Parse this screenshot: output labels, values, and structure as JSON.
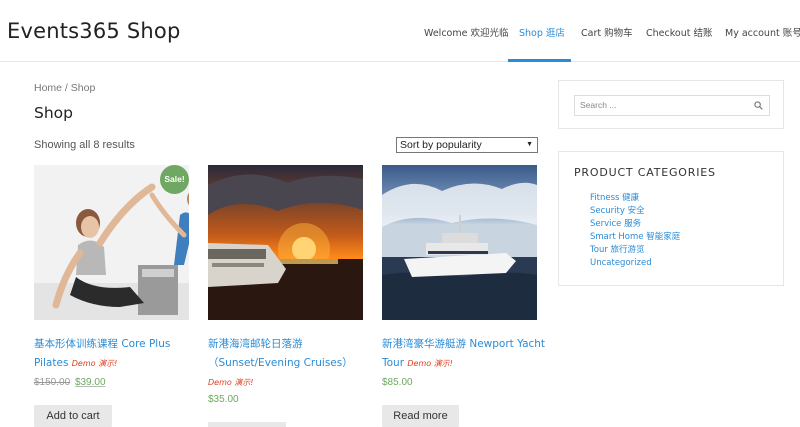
{
  "site": {
    "title": "Events365 Shop"
  },
  "nav": {
    "items": [
      {
        "label": "Welcome 欢迎光临",
        "active": false
      },
      {
        "label": "Shop 逛店",
        "active": true
      },
      {
        "label": "Cart 购物车",
        "active": false
      },
      {
        "label": "Checkout 结账",
        "active": false
      },
      {
        "label": "My account 账号",
        "active": false
      }
    ]
  },
  "breadcrumb": {
    "home": "Home",
    "separator": " / ",
    "current": "Shop"
  },
  "page": {
    "title": "Shop",
    "result_count": "Showing all 8 results"
  },
  "sort": {
    "selected": "Sort by popularity"
  },
  "products": [
    {
      "title": "基本形体训练课程 Core Plus Pilates",
      "demo": "Demo 演示!",
      "sale_badge": "Sale!",
      "regular_price": "$150.00",
      "sale_price": "$39.00",
      "button": "Add to cart"
    },
    {
      "title": "新港海湾邮轮日落游 （Sunset/Evening Cruises）",
      "demo": "Demo 演示!",
      "price": "$35.00",
      "button": ""
    },
    {
      "title": "新港湾豪华游艇游 Newport Yacht Tour",
      "demo": "Demo 演示!",
      "price": "$85.00",
      "button": "Read more"
    }
  ],
  "sidebar": {
    "search": {
      "placeholder": "Search ..."
    },
    "categories": {
      "title": "PRODUCT CATEGORIES",
      "items": [
        "Fitness 健康",
        "Security 安全",
        "Service 服务",
        "Smart Home 智能家庭",
        "Tour 旅行游览",
        "Uncategorized"
      ]
    }
  },
  "colors": {
    "accent": "#2a8bd6",
    "sale": "#6fa862",
    "demo": "#e03a1e"
  }
}
